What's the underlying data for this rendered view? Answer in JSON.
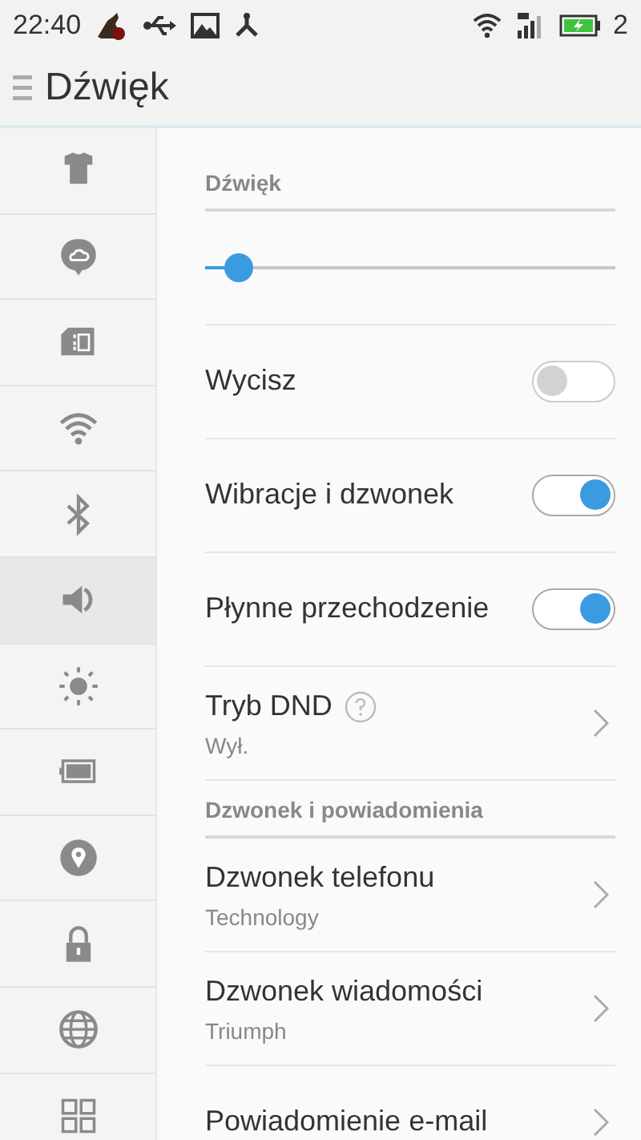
{
  "status_bar": {
    "time": "22:40",
    "battery_text": "2"
  },
  "header": {
    "title": "Dźwięk"
  },
  "sidebar": {
    "items": [
      {
        "selected": false
      },
      {
        "selected": false
      },
      {
        "selected": false
      },
      {
        "selected": false
      },
      {
        "selected": false
      },
      {
        "selected": true
      },
      {
        "selected": false
      },
      {
        "selected": false
      },
      {
        "selected": false
      },
      {
        "selected": false
      },
      {
        "selected": false
      },
      {
        "selected": false
      }
    ]
  },
  "sections": [
    {
      "title": "Dźwięk",
      "rows": [
        {
          "kind": "slider",
          "level": 0.06
        },
        {
          "kind": "toggle",
          "label": "Wycisz",
          "on": false
        },
        {
          "kind": "toggle",
          "label": "Wibracje i dzwonek",
          "on": true
        },
        {
          "kind": "toggle",
          "label": "Płynne przechodzenie",
          "on": true
        },
        {
          "kind": "nav",
          "label": "Tryb DND",
          "help": true,
          "subtitle": "Wył."
        }
      ]
    },
    {
      "title": "Dzwonek i powiadomienia",
      "rows": [
        {
          "kind": "nav",
          "label": "Dzwonek telefonu",
          "subtitle": "Technology"
        },
        {
          "kind": "nav",
          "label": "Dzwonek wiadomości",
          "subtitle": "Triumph"
        },
        {
          "kind": "nav",
          "label": "Powiadomienie e-mail"
        }
      ]
    }
  ]
}
